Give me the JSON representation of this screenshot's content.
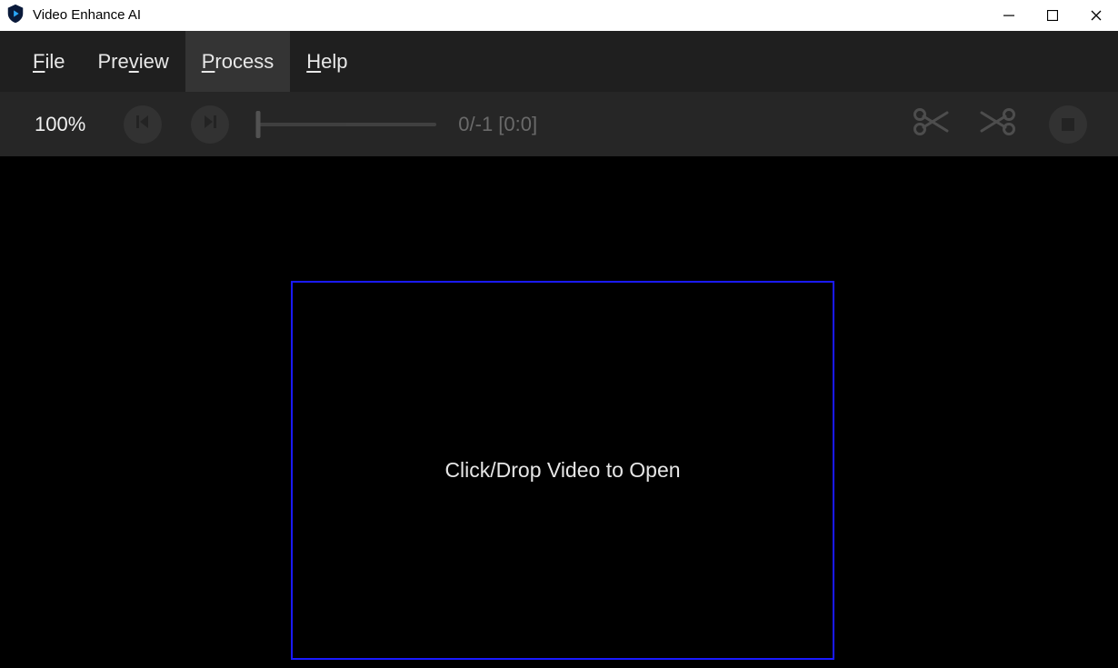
{
  "titlebar": {
    "title": "Video Enhance AI"
  },
  "menu": {
    "file_pre": "",
    "file_u": "F",
    "file_rest": "ile",
    "preview_pre": "Pre",
    "preview_u": "v",
    "preview_rest": "iew",
    "process_pre": "",
    "process_u": "P",
    "process_rest": "rocess",
    "help_pre": "",
    "help_u": "H",
    "help_rest": "elp"
  },
  "toolbar": {
    "zoom": "100%",
    "frame_info": "0/-1  [0:0]"
  },
  "dropzone": {
    "label": "Click/Drop Video to Open"
  }
}
